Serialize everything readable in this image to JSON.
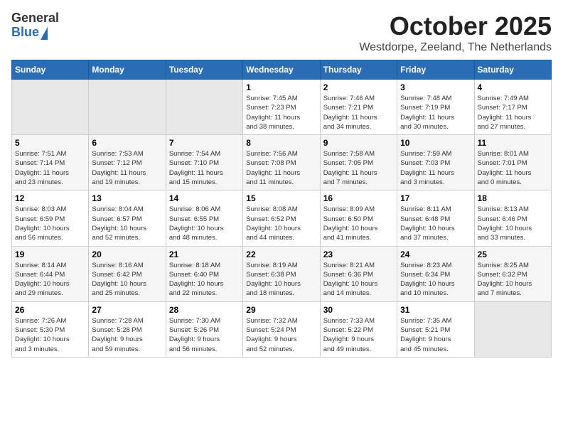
{
  "logo": {
    "general": "General",
    "blue": "Blue"
  },
  "title": "October 2025",
  "location": "Westdorpe, Zeeland, The Netherlands",
  "weekdays": [
    "Sunday",
    "Monday",
    "Tuesday",
    "Wednesday",
    "Thursday",
    "Friday",
    "Saturday"
  ],
  "weeks": [
    [
      {
        "day": "",
        "info": ""
      },
      {
        "day": "",
        "info": ""
      },
      {
        "day": "",
        "info": ""
      },
      {
        "day": "1",
        "info": "Sunrise: 7:45 AM\nSunset: 7:23 PM\nDaylight: 11 hours\nand 38 minutes."
      },
      {
        "day": "2",
        "info": "Sunrise: 7:46 AM\nSunset: 7:21 PM\nDaylight: 11 hours\nand 34 minutes."
      },
      {
        "day": "3",
        "info": "Sunrise: 7:48 AM\nSunset: 7:19 PM\nDaylight: 11 hours\nand 30 minutes."
      },
      {
        "day": "4",
        "info": "Sunrise: 7:49 AM\nSunset: 7:17 PM\nDaylight: 11 hours\nand 27 minutes."
      }
    ],
    [
      {
        "day": "5",
        "info": "Sunrise: 7:51 AM\nSunset: 7:14 PM\nDaylight: 11 hours\nand 23 minutes."
      },
      {
        "day": "6",
        "info": "Sunrise: 7:53 AM\nSunset: 7:12 PM\nDaylight: 11 hours\nand 19 minutes."
      },
      {
        "day": "7",
        "info": "Sunrise: 7:54 AM\nSunset: 7:10 PM\nDaylight: 11 hours\nand 15 minutes."
      },
      {
        "day": "8",
        "info": "Sunrise: 7:56 AM\nSunset: 7:08 PM\nDaylight: 11 hours\nand 11 minutes."
      },
      {
        "day": "9",
        "info": "Sunrise: 7:58 AM\nSunset: 7:05 PM\nDaylight: 11 hours\nand 7 minutes."
      },
      {
        "day": "10",
        "info": "Sunrise: 7:59 AM\nSunset: 7:03 PM\nDaylight: 11 hours\nand 3 minutes."
      },
      {
        "day": "11",
        "info": "Sunrise: 8:01 AM\nSunset: 7:01 PM\nDaylight: 11 hours\nand 0 minutes."
      }
    ],
    [
      {
        "day": "12",
        "info": "Sunrise: 8:03 AM\nSunset: 6:59 PM\nDaylight: 10 hours\nand 56 minutes."
      },
      {
        "day": "13",
        "info": "Sunrise: 8:04 AM\nSunset: 6:57 PM\nDaylight: 10 hours\nand 52 minutes."
      },
      {
        "day": "14",
        "info": "Sunrise: 8:06 AM\nSunset: 6:55 PM\nDaylight: 10 hours\nand 48 minutes."
      },
      {
        "day": "15",
        "info": "Sunrise: 8:08 AM\nSunset: 6:52 PM\nDaylight: 10 hours\nand 44 minutes."
      },
      {
        "day": "16",
        "info": "Sunrise: 8:09 AM\nSunset: 6:50 PM\nDaylight: 10 hours\nand 41 minutes."
      },
      {
        "day": "17",
        "info": "Sunrise: 8:11 AM\nSunset: 6:48 PM\nDaylight: 10 hours\nand 37 minutes."
      },
      {
        "day": "18",
        "info": "Sunrise: 8:13 AM\nSunset: 6:46 PM\nDaylight: 10 hours\nand 33 minutes."
      }
    ],
    [
      {
        "day": "19",
        "info": "Sunrise: 8:14 AM\nSunset: 6:44 PM\nDaylight: 10 hours\nand 29 minutes."
      },
      {
        "day": "20",
        "info": "Sunrise: 8:16 AM\nSunset: 6:42 PM\nDaylight: 10 hours\nand 25 minutes."
      },
      {
        "day": "21",
        "info": "Sunrise: 8:18 AM\nSunset: 6:40 PM\nDaylight: 10 hours\nand 22 minutes."
      },
      {
        "day": "22",
        "info": "Sunrise: 8:19 AM\nSunset: 6:38 PM\nDaylight: 10 hours\nand 18 minutes."
      },
      {
        "day": "23",
        "info": "Sunrise: 8:21 AM\nSunset: 6:36 PM\nDaylight: 10 hours\nand 14 minutes."
      },
      {
        "day": "24",
        "info": "Sunrise: 8:23 AM\nSunset: 6:34 PM\nDaylight: 10 hours\nand 10 minutes."
      },
      {
        "day": "25",
        "info": "Sunrise: 8:25 AM\nSunset: 6:32 PM\nDaylight: 10 hours\nand 7 minutes."
      }
    ],
    [
      {
        "day": "26",
        "info": "Sunrise: 7:26 AM\nSunset: 5:30 PM\nDaylight: 10 hours\nand 3 minutes."
      },
      {
        "day": "27",
        "info": "Sunrise: 7:28 AM\nSunset: 5:28 PM\nDaylight: 9 hours\nand 59 minutes."
      },
      {
        "day": "28",
        "info": "Sunrise: 7:30 AM\nSunset: 5:26 PM\nDaylight: 9 hours\nand 56 minutes."
      },
      {
        "day": "29",
        "info": "Sunrise: 7:32 AM\nSunset: 5:24 PM\nDaylight: 9 hours\nand 52 minutes."
      },
      {
        "day": "30",
        "info": "Sunrise: 7:33 AM\nSunset: 5:22 PM\nDaylight: 9 hours\nand 49 minutes."
      },
      {
        "day": "31",
        "info": "Sunrise: 7:35 AM\nSunset: 5:21 PM\nDaylight: 9 hours\nand 45 minutes."
      },
      {
        "day": "",
        "info": ""
      }
    ]
  ]
}
